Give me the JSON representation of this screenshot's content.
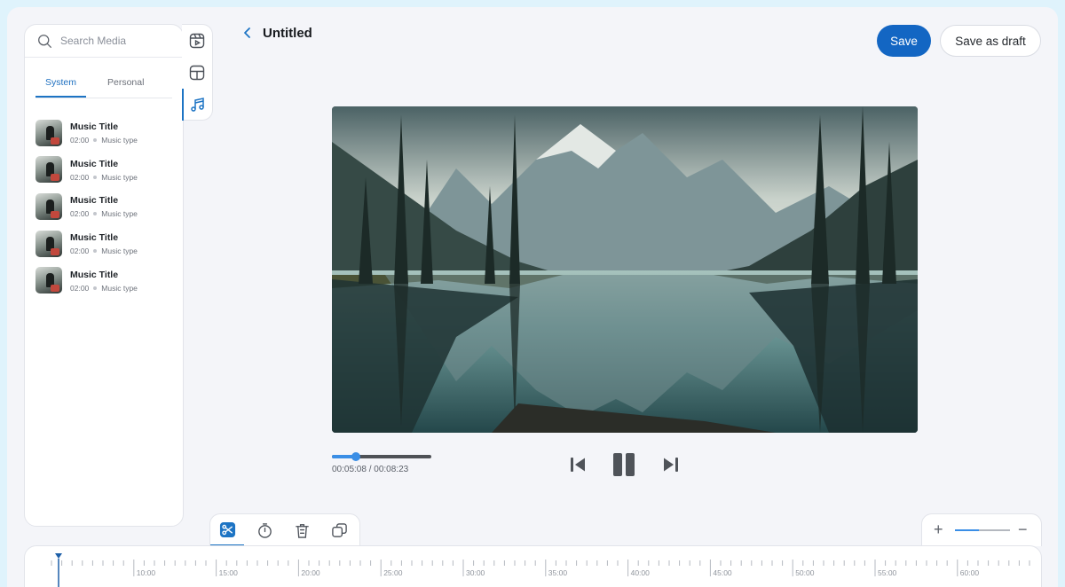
{
  "sidebar": {
    "search_placeholder": "Search Media",
    "tabs": [
      {
        "label": "System",
        "active": true
      },
      {
        "label": "Personal",
        "active": false
      }
    ],
    "items": [
      {
        "title": "Music Title",
        "duration": "02:00",
        "type": "Music type"
      },
      {
        "title": "Music Title",
        "duration": "02:00",
        "type": "Music type"
      },
      {
        "title": "Music Title",
        "duration": "02:00",
        "type": "Music type"
      },
      {
        "title": "Music Title",
        "duration": "02:00",
        "type": "Music type"
      },
      {
        "title": "Music Title",
        "duration": "02:00",
        "type": "Music type"
      }
    ]
  },
  "vertical_toolbar": {
    "icons": [
      "video-reel-icon",
      "layout-icon",
      "music-note-icon"
    ],
    "active": "music-note-icon"
  },
  "header": {
    "title": "Untitled",
    "back_icon": "chevron-left-icon",
    "save_label": "Save",
    "draft_label": "Save as draft"
  },
  "player": {
    "time_display": "00:05:08 / 00:08:23",
    "progress_fraction": 0.24,
    "state": "playing",
    "icons": [
      "skip-back-icon",
      "pause-icon",
      "skip-forward-icon"
    ]
  },
  "bottom_tools": {
    "icons": [
      "scissors-icon",
      "timer-icon",
      "trash-icon",
      "duplicate-icon"
    ],
    "active": "scissors-icon"
  },
  "zoom": {
    "plus": "+",
    "minus": "−",
    "level_fraction": 0.43
  },
  "timeline": {
    "labels": [
      "10:00",
      "15:00",
      "20:00",
      "25:00",
      "30:00",
      "35:00",
      "40:00",
      "45:00",
      "50:00",
      "55:00",
      "60:00"
    ],
    "minor_ticks_per_label": 8
  },
  "colors": {
    "accent": "#1366c3",
    "accent_light": "#3a8ee6",
    "background": "#f4f5f9",
    "outer": "#dff3fc"
  }
}
